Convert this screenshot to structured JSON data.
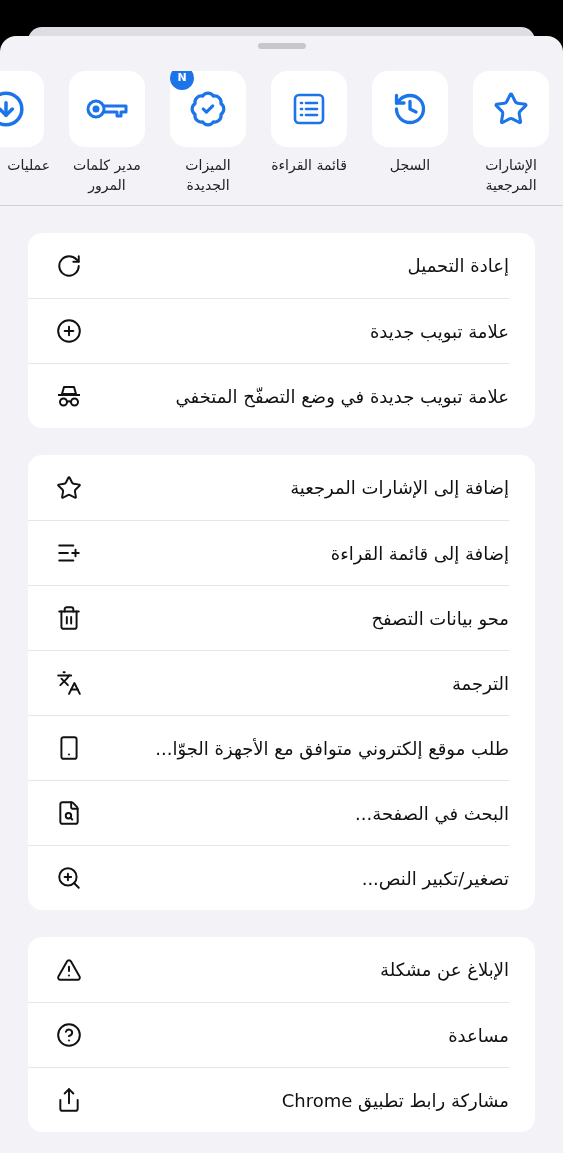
{
  "shortcuts": [
    {
      "label": "الإشارات المرجعية"
    },
    {
      "label": "السجل"
    },
    {
      "label": "قائمة القراءة"
    },
    {
      "label": "الميزات الجديدة",
      "badge": "N"
    },
    {
      "label": "مدير كلمات المرور"
    },
    {
      "label": "عمليات"
    }
  ],
  "sections": [
    {
      "items": [
        {
          "label": "إعادة التحميل"
        },
        {
          "label": "علامة تبويب جديدة"
        },
        {
          "label": "علامة تبويب جديدة في وضع التصفّح المتخفي"
        }
      ]
    },
    {
      "items": [
        {
          "label": "إضافة إلى الإشارات المرجعية"
        },
        {
          "label": "إضافة إلى قائمة القراءة"
        },
        {
          "label": "محو بيانات التصفح"
        },
        {
          "label": "الترجمة"
        },
        {
          "label": "طلب موقع إلكتروني متوافق مع الأجهزة الجوّا..."
        },
        {
          "label": "البحث في الصفحة..."
        },
        {
          "label": "تصغير/تكبير النص..."
        }
      ]
    },
    {
      "items": [
        {
          "label": "الإبلاغ عن مشكلة"
        },
        {
          "label": "مساعدة"
        },
        {
          "label": "مشاركة رابط تطبيق Chrome"
        }
      ]
    }
  ]
}
